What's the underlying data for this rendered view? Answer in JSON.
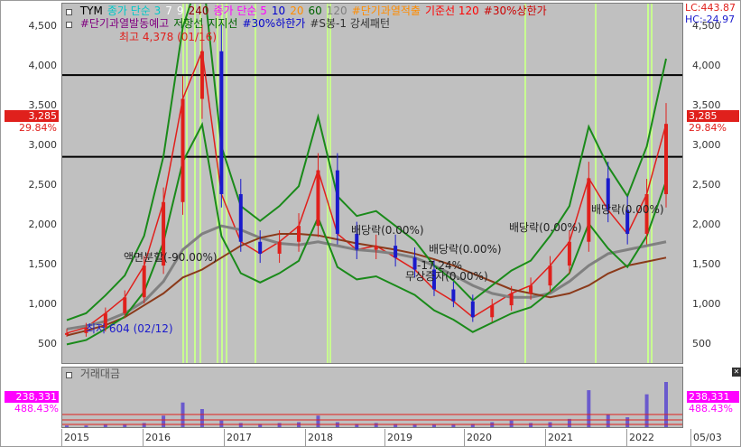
{
  "symbol": "TYM",
  "legend": {
    "line1": [
      {
        "text": "TYM",
        "color": "#000000"
      },
      {
        "text": "종가 단순 3",
        "color": "#00c8c8"
      },
      {
        "text": "7",
        "color": "#ffffff"
      },
      {
        "text": "9",
        "color": "#ffffff"
      },
      {
        "text": "240",
        "color": "#8b0000"
      },
      {
        "text": "종가 단순 5",
        "color": "#ff00ff"
      },
      {
        "text": "10",
        "color": "#0000cc"
      },
      {
        "text": "20",
        "color": "#ff8c00"
      },
      {
        "text": "60",
        "color": "#006400"
      },
      {
        "text": "120",
        "color": "#808080"
      },
      {
        "text": "#단기과열적출",
        "color": "#ff8c00"
      },
      {
        "text": "기준선 120",
        "color": "#ff0000"
      },
      {
        "text": "#30%상한가",
        "color": "#cc0000"
      }
    ],
    "line2": [
      {
        "text": "#단기과열발동예고",
        "color": "#800080"
      },
      {
        "text": "저항선",
        "color": "#006400"
      },
      {
        "text": "지지선",
        "color": "#006400"
      },
      {
        "text": "#30%하한가",
        "color": "#0000cc"
      },
      {
        "text": "#S봉-1 강세패턴",
        "color": "#333333"
      }
    ]
  },
  "right_header": {
    "lc": "LC:443.87",
    "hc": "HC:-24.97"
  },
  "current_price": {
    "value": "3,285",
    "change_pct": "29.84%"
  },
  "volume_panel": {
    "title": "거래대금",
    "value": "238,331",
    "change_pct": "488.43%"
  },
  "y_axis_labels": [
    "4,500",
    "4,000",
    "3,500",
    "3,000",
    "2,500",
    "2,000",
    "1,500",
    "1,000",
    "500"
  ],
  "y_axis_values": [
    4500,
    4000,
    3500,
    3000,
    2500,
    2000,
    1500,
    1000,
    500
  ],
  "x_axis_labels": [
    "2015",
    "2016",
    "2017",
    "2018",
    "2019",
    "2020",
    "2021",
    "2022",
    "05/03"
  ],
  "annotations": {
    "high": "최고 4,378 (01/16)",
    "low": "최저 604 (02/12)",
    "split": "액면분할(-90.00%)",
    "div1": "배당락(0.00%)",
    "div2": "배당락(0.00%)",
    "div3": "배당락(0.00%)",
    "div4": "배당락(0.00%)",
    "rights": "무상증자(0.00%)",
    "rights_pct": "-17.24%"
  },
  "horizontal_lines": [
    3900,
    2870
  ],
  "colors": {
    "plot_bg": "#c0c0c0",
    "price_badge": "#e0201c",
    "volume_badge": "#ff00ff",
    "highlight_bar": "#c8ff90",
    "bollinger": "#1a8a1a",
    "ma240": "#8b3a1a",
    "ma120": "#808080",
    "baseline": "#ff0000"
  },
  "chart_data": {
    "type": "line",
    "title": "",
    "xlabel": "",
    "ylabel": "",
    "ylim": [
      250,
      4800
    ],
    "x": [
      "2015-01",
      "2015-06",
      "2015-12",
      "2016-03",
      "2016-06",
      "2016-09",
      "2016-12",
      "2017-01",
      "2017-03",
      "2017-06",
      "2017-09",
      "2017-12",
      "2018-01",
      "2018-02",
      "2018-06",
      "2018-09",
      "2018-12",
      "2019-03",
      "2019-06",
      "2019-09",
      "2019-12",
      "2020-03",
      "2020-06",
      "2020-09",
      "2020-12",
      "2021-03",
      "2021-06",
      "2021-09",
      "2021-12",
      "2022-03",
      "2022-04",
      "2022-05"
    ],
    "series": [
      {
        "values": [
          650,
          720,
          900,
          1100,
          1500,
          2300,
          3600,
          4200,
          2400,
          1800,
          1650,
          1800,
          2000,
          2700,
          1900,
          1700,
          1750,
          1600,
          1450,
          1200,
          1050,
          850,
          1000,
          1150,
          1250,
          1500,
          1800,
          2600,
          2200,
          1900,
          2400,
          3285
        ]
      },
      {
        "values": [
          700,
          740,
          800,
          900,
          1050,
          1300,
          1700,
          1900,
          2000,
          1950,
          1850,
          1780,
          1760,
          1800,
          1750,
          1700,
          1680,
          1650,
          1600,
          1500,
          1380,
          1250,
          1150,
          1100,
          1100,
          1150,
          1300,
          1500,
          1650,
          1700,
          1750,
          1800
        ]
      },
      {
        "values": [
          620,
          680,
          750,
          850,
          1000,
          1150,
          1350,
          1450,
          1600,
          1750,
          1850,
          1900,
          1900,
          1880,
          1830,
          1780,
          1740,
          1700,
          1650,
          1580,
          1500,
          1400,
          1300,
          1200,
          1150,
          1100,
          1150,
          1250,
          1400,
          1500,
          1550,
          1600
        ]
      }
    ]
  },
  "volume_data": [
    2,
    2,
    3,
    3,
    5,
    14,
    30,
    22,
    8,
    5,
    4,
    5,
    6,
    14,
    6,
    4,
    5,
    4,
    3,
    3,
    3,
    4,
    6,
    8,
    5,
    6,
    10,
    45,
    15,
    12,
    40,
    55
  ]
}
